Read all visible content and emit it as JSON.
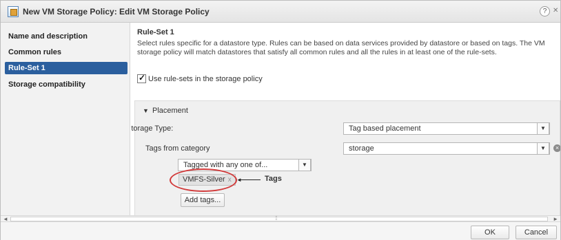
{
  "window": {
    "title": "New VM Storage Policy: Edit VM Storage Policy",
    "help_symbol": "?",
    "close_symbol": "✕"
  },
  "nav": {
    "items": [
      {
        "label": "Name and description",
        "active": false
      },
      {
        "label": "Common rules",
        "active": false
      },
      {
        "label": "Rule-Set 1",
        "active": true
      },
      {
        "label": "Storage compatibility",
        "active": false
      }
    ]
  },
  "main": {
    "title": "Rule-Set 1",
    "description": "Select rules specific for a datastore type. Rules can be based on data services provided by datastore or based on tags. The VM storage policy will match datastores that satisfy all common rules and all the rules in at least one of the rule-sets.",
    "use_rulesets": {
      "label": "Use rule-sets in the storage policy",
      "checked": true
    },
    "placement": {
      "section_label": "Placement",
      "storage_type_label": "Storage Type:",
      "storage_type_value": "Tag based placement",
      "tags_from_category_label": "Tags from category",
      "category_value": "storage",
      "tag_match_value": "Tagged with any one of...",
      "tag_chip": "VMFS-Silver",
      "tag_chip_remove": "x",
      "annotation_label": "Tags",
      "add_tags_label": "Add tags..."
    }
  },
  "footer": {
    "ok_label": "OK",
    "cancel_label": "Cancel"
  },
  "colors": {
    "nav_active": "#2b5f9e",
    "annotation_circle": "#d23a3a"
  },
  "icons": {
    "window_icon": "vm-storage-policy-icon",
    "help": "help-icon",
    "expand": "triangle-down-icon",
    "remove": "remove-circle-icon"
  }
}
